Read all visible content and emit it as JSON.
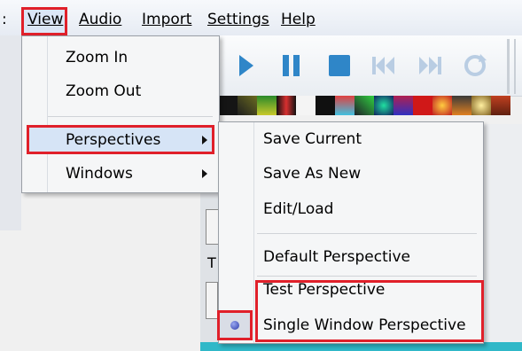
{
  "menubar": {
    "lead": ":",
    "items": [
      "View",
      "Audio",
      "Import",
      "Settings",
      "Help"
    ]
  },
  "view_menu": {
    "items": [
      "Zoom In",
      "Zoom Out",
      "Perspectives",
      "Windows"
    ]
  },
  "perspectives_menu": {
    "items": [
      "Save Current",
      "Save As New",
      "Edit/Load",
      "Default Perspective",
      "Test Perspective",
      "Single Window Perspective"
    ],
    "selected": "Single Window Perspective"
  },
  "background": {
    "panel_letter": "T"
  },
  "colors": {
    "highlight_border": "#e0202a",
    "menu_highlight": "#d6e4f6",
    "transport_blue": "#2f86c8",
    "transport_disabled": "#b9cde3"
  },
  "icons": [
    "play-icon",
    "pause-icon",
    "stop-icon",
    "previous-icon",
    "next-icon",
    "repeat-icon",
    "submenu-arrow-icon",
    "radio-selected-icon"
  ]
}
